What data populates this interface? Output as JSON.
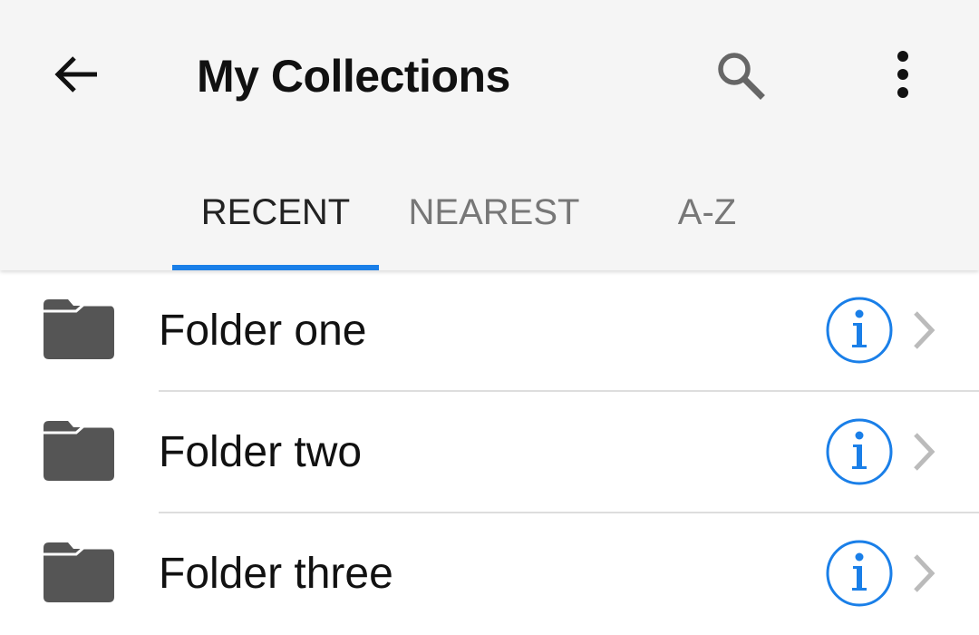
{
  "header": {
    "title": "My Collections",
    "back_icon": "arrow-back-icon",
    "search_icon": "search-icon",
    "more_icon": "more-vertical-icon"
  },
  "tabs": [
    {
      "label": "RECENT",
      "selected": true
    },
    {
      "label": "NEAREST",
      "selected": false
    },
    {
      "label": "A-Z",
      "selected": false
    }
  ],
  "folders": [
    {
      "name": "Folder one",
      "icon": "folder-icon"
    },
    {
      "name": "Folder two",
      "icon": "folder-icon"
    },
    {
      "name": "Folder three",
      "icon": "folder-icon"
    }
  ],
  "colors": {
    "accent": "#1a7fe8",
    "appbar_background": "#f5f5f5",
    "folder_icon": "#555555",
    "chevron": "#bbbbbb",
    "tab_inactive": "#777777"
  }
}
